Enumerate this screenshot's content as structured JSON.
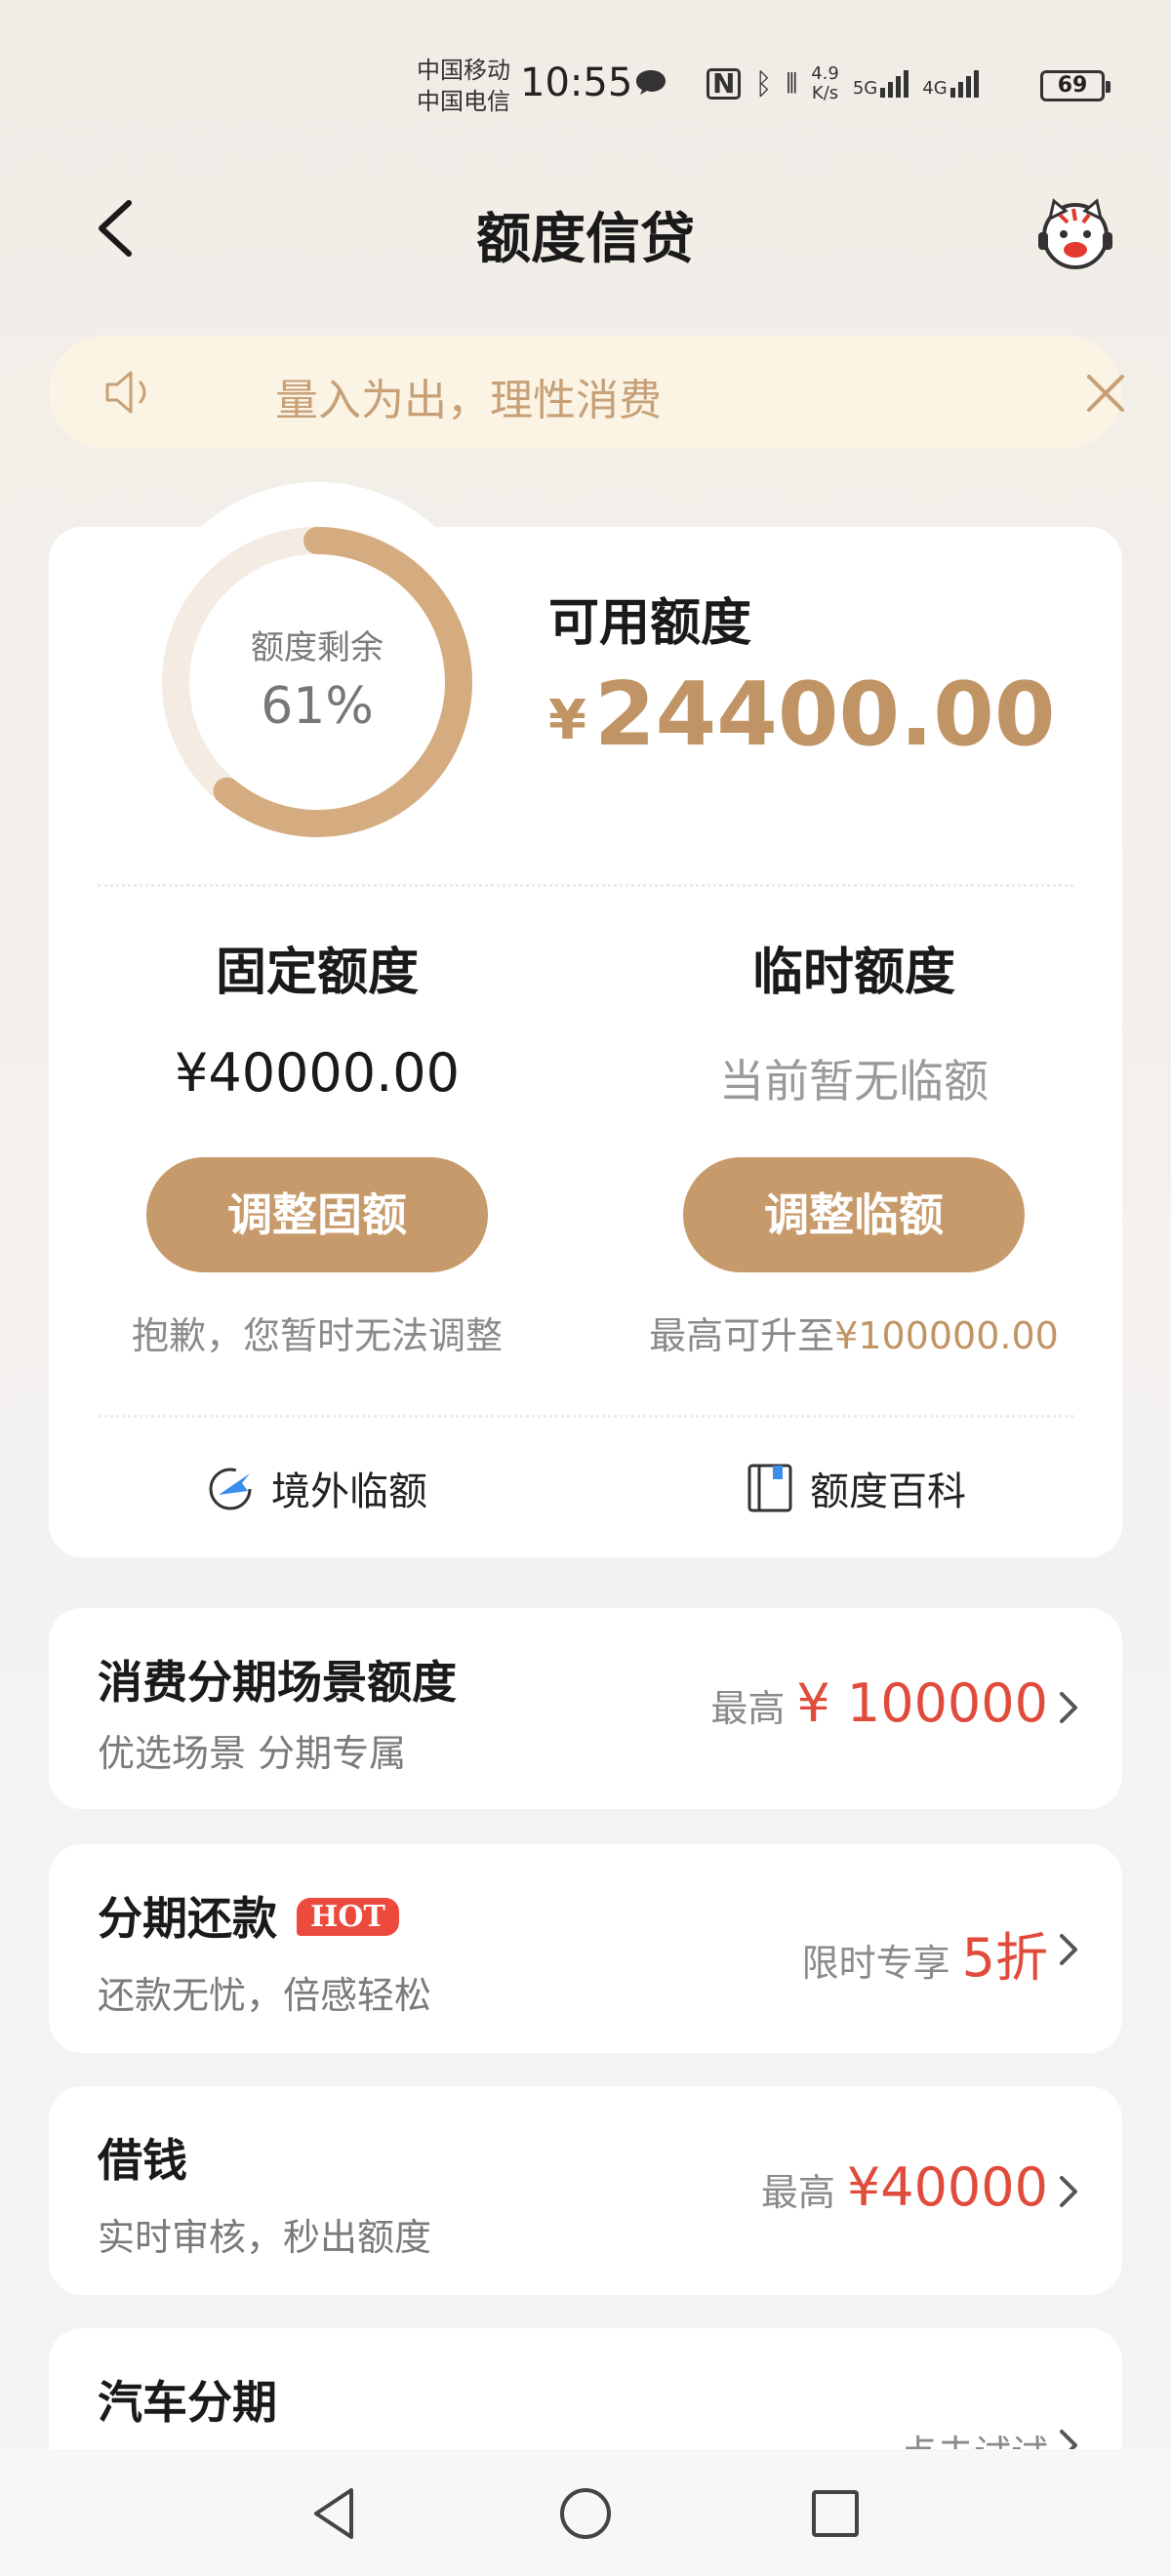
{
  "status_bar": {
    "carrier1": "中国移动",
    "carrier2": "中国电信",
    "time": "10:55",
    "net_speed_top": "4.9",
    "net_speed_bottom": "K/s",
    "sig1": "5G",
    "sig2": "4G",
    "battery": "69"
  },
  "header": {
    "title": "额度信贷"
  },
  "notice": {
    "text": "量入为出，理性消费"
  },
  "overview": {
    "ring_label": "额度剩余",
    "ring_value": "61%",
    "ring_fraction": 0.61,
    "available_label": "可用额度",
    "available_currency": "¥",
    "available_value": "24400.00",
    "fixed": {
      "title": "固定额度",
      "amount": "¥40000.00",
      "button": "调整固额",
      "note": "抱歉，您暂时无法调整"
    },
    "temp": {
      "title": "临时额度",
      "amount": "当前暂无临额",
      "button": "调整临额",
      "note_prefix": "最高可升至",
      "note_value": "¥100000.00"
    },
    "links": {
      "overseas": "境外临额",
      "wiki": "额度百科"
    }
  },
  "items": [
    {
      "title": "消费分期场景额度",
      "subtitle": "优选场景 分期专属",
      "prefix": "最高",
      "value": "¥ 100000"
    },
    {
      "title": "分期还款",
      "badge": "HOT",
      "subtitle": "还款无忧，倍感轻松",
      "prefix": "限时专享",
      "value": "5折"
    },
    {
      "title": "借钱",
      "subtitle": "实时审核，秒出额度",
      "prefix": "最高",
      "value": "¥40000"
    },
    {
      "title": "汽车分期",
      "action": "点击试试"
    }
  ],
  "colors": {
    "accent": "#c19465",
    "button": "#c79a6b",
    "highlight_red": "#e14b3b",
    "notice_bg": "#fbf3e3"
  }
}
